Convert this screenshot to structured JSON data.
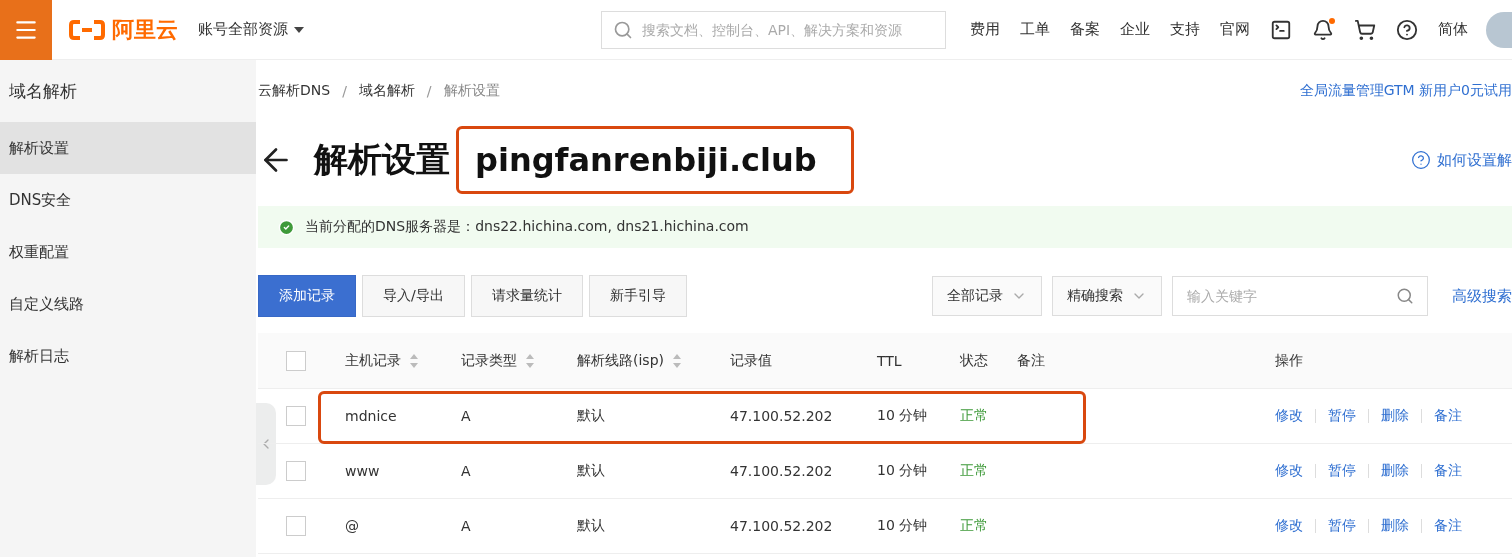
{
  "topbar": {
    "logo": "阿里云",
    "account": "账号全部资源",
    "search": {
      "placeholder": "搜索文档、控制台、API、解决方案和资源"
    },
    "links": [
      "费用",
      "工单",
      "备案",
      "企业",
      "支持",
      "官网"
    ],
    "notification_dot": true,
    "language": "简体"
  },
  "sidebar": {
    "title": "域名解析",
    "items": [
      {
        "label": "解析设置",
        "selected": true
      },
      {
        "label": "DNS安全",
        "selected": false
      },
      {
        "label": "权重配置",
        "selected": false
      },
      {
        "label": "自定义线路",
        "selected": false
      },
      {
        "label": "解析日志",
        "selected": false
      }
    ]
  },
  "breadcrumb": [
    {
      "kind": "link",
      "label": "云解析DNS"
    },
    {
      "kind": "separator",
      "label": "/"
    },
    {
      "kind": "link",
      "label": "域名解析"
    },
    {
      "kind": "separator",
      "label": "/"
    },
    {
      "kind": "current",
      "label": "解析设置"
    }
  ],
  "promo_link": "全局流量管理GTM 新用户0元试用",
  "title": {
    "label": "解析设置",
    "domain": "pingfanrenbiji.club",
    "annotated": true
  },
  "help_link": "如何设置解",
  "notice": "当前分配的DNS服务器是：dns22.hichina.com, dns21.hichina.com",
  "toolbar": {
    "buttons": [
      {
        "label": "添加记录",
        "primary": true
      },
      {
        "label": "导入/导出",
        "primary": false
      },
      {
        "label": "请求量统计",
        "primary": false
      },
      {
        "label": "新手引导",
        "primary": false
      }
    ],
    "filters": [
      "全部记录",
      "精确搜索"
    ],
    "keyword": {
      "placeholder": "输入关键字"
    },
    "advanced": "高级搜索"
  },
  "table": {
    "select_all_checked": false,
    "columns": [
      {
        "label": "主机记录",
        "sortable": true
      },
      {
        "label": "记录类型",
        "sortable": true
      },
      {
        "label": "解析线路(isp)",
        "sortable": true
      },
      {
        "label": "记录值",
        "sortable": false
      },
      {
        "label": "TTL",
        "sortable": false
      },
      {
        "label": "状态",
        "sortable": false
      },
      {
        "label": "备注",
        "sortable": false
      },
      {
        "label": "操作",
        "sortable": false
      }
    ],
    "rows": [
      {
        "checked": false,
        "annotated": true,
        "cells": [
          "mdnice",
          "A",
          "默认",
          "47.100.52.202",
          "10 分钟",
          "正常"
        ],
        "actions": [
          "修改",
          "暂停",
          "删除",
          "备注"
        ]
      },
      {
        "checked": false,
        "annotated": false,
        "cells": [
          "www",
          "A",
          "默认",
          "47.100.52.202",
          "10 分钟",
          "正常"
        ],
        "actions": [
          "修改",
          "暂停",
          "删除",
          "备注"
        ]
      },
      {
        "checked": false,
        "annotated": false,
        "cells": [
          "@",
          "A",
          "默认",
          "47.100.52.202",
          "10 分钟",
          "正常"
        ],
        "actions": [
          "修改",
          "暂停",
          "删除",
          "备注"
        ]
      }
    ]
  }
}
